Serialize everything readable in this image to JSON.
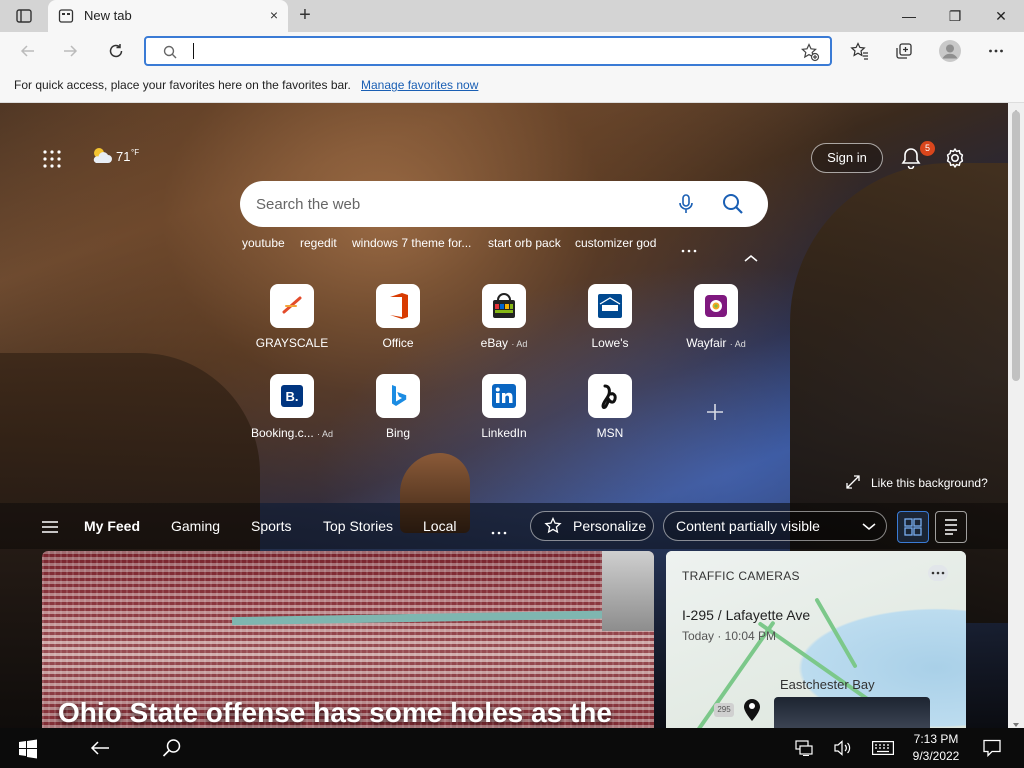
{
  "tab": {
    "title": "New tab",
    "close": "×",
    "new": "+"
  },
  "window_controls": {
    "min": "—",
    "max": "❐",
    "close": "✕"
  },
  "address": {
    "value": "",
    "placeholder": ""
  },
  "favbar": {
    "text": "For quick access, place your favorites here on the favorites bar.",
    "link": "Manage favorites now"
  },
  "weather": {
    "temp": "71",
    "unit": "°F"
  },
  "signin": "Sign in",
  "notifications": {
    "count": "5"
  },
  "search": {
    "placeholder": "Search the web"
  },
  "suggestions": [
    "youtube",
    "regedit",
    "windows 7 theme for...",
    "start orb pack",
    "customizer god"
  ],
  "tiles": [
    {
      "label": "GRAYSCALE",
      "ad": ""
    },
    {
      "label": "Office",
      "ad": ""
    },
    {
      "label": "eBay",
      "ad": "· Ad"
    },
    {
      "label": "Lowe's",
      "ad": ""
    },
    {
      "label": "Wayfair",
      "ad": "· Ad"
    },
    {
      "label": "Booking.c...",
      "ad": "· Ad"
    },
    {
      "label": "Bing",
      "ad": ""
    },
    {
      "label": "LinkedIn",
      "ad": ""
    },
    {
      "label": "MSN",
      "ad": ""
    }
  ],
  "like_background": "Like this background?",
  "feed": {
    "tabs": [
      "My Feed",
      "Gaming",
      "Sports",
      "Top Stories",
      "Local"
    ],
    "personalize": "Personalize",
    "visibility": "Content partially visible"
  },
  "card_main": {
    "headline": "Ohio State offense has some holes as the"
  },
  "card_traffic": {
    "heading": "TRAFFIC CAMERAS",
    "location": "I-295 / Lafayette Ave",
    "time": "Today · 10:04 PM",
    "place": "Eastchester Bay",
    "route": "295"
  },
  "clock": {
    "time": "7:13 PM",
    "date": "9/3/2022"
  },
  "colors": {
    "accent": "#3a7bd5",
    "badge": "#d9461c",
    "link": "#1a5fb4"
  }
}
